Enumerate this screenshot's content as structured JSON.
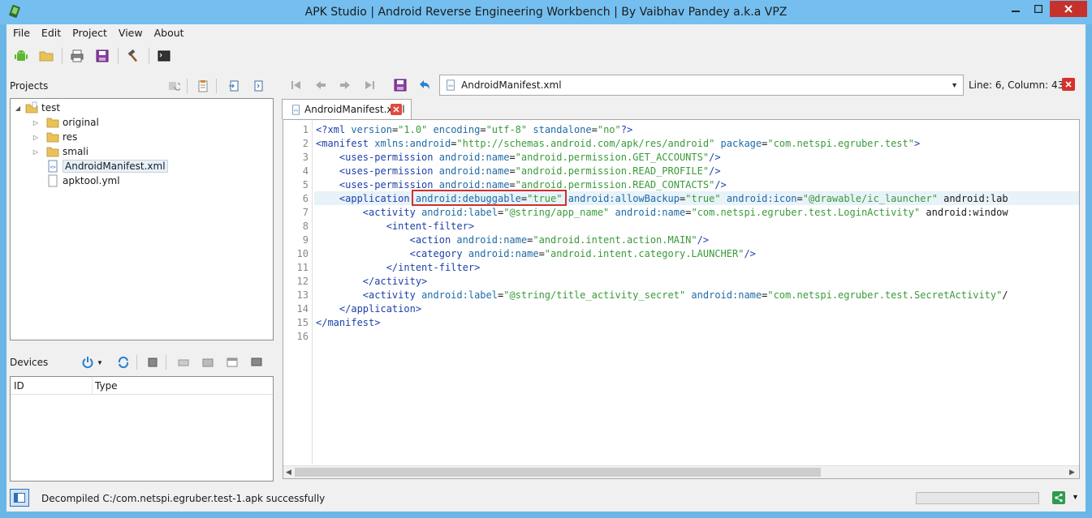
{
  "window": {
    "title": "APK Studio | Android Reverse Engineering Workbench | By Vaibhav Pandey a.k.a VPZ"
  },
  "menu": [
    "File",
    "Edit",
    "Project",
    "View",
    "About"
  ],
  "projects": {
    "title": "Projects",
    "tree": [
      {
        "label": "test",
        "level": 0,
        "expanded": true,
        "type": "project"
      },
      {
        "label": "original",
        "level": 1,
        "expanded": false,
        "type": "folder"
      },
      {
        "label": "res",
        "level": 1,
        "expanded": false,
        "type": "folder"
      },
      {
        "label": "smali",
        "level": 1,
        "expanded": false,
        "type": "folder"
      },
      {
        "label": "AndroidManifest.xml",
        "level": 1,
        "type": "xml",
        "selected": true
      },
      {
        "label": "apktool.yml",
        "level": 1,
        "type": "file"
      }
    ]
  },
  "devices": {
    "title": "Devices",
    "columns": [
      "ID",
      "Type"
    ]
  },
  "editor": {
    "open_file": "AndroidManifest.xml",
    "position": "Line: 6, Column: 43",
    "tab_label": "AndroidManifest.xml",
    "lines": [
      "<?xml version=\"1.0\" encoding=\"utf-8\" standalone=\"no\"?>",
      "<manifest xmlns:android=\"http://schemas.android.com/apk/res/android\" package=\"com.netspi.egruber.test\">",
      "    <uses-permission android:name=\"android.permission.GET_ACCOUNTS\"/>",
      "    <uses-permission android:name=\"android.permission.READ_PROFILE\"/>",
      "    <uses-permission android:name=\"android.permission.READ_CONTACTS\"/>",
      "    <application android:debuggable=\"true\" android:allowBackup=\"true\" android:icon=\"@drawable/ic_launcher\" android:lab",
      "        <activity android:label=\"@string/app_name\" android:name=\"com.netspi.egruber.test.LoginActivity\" android:window",
      "            <intent-filter>",
      "                <action android:name=\"android.intent.action.MAIN\"/>",
      "                <category android:name=\"android.intent.category.LAUNCHER\"/>",
      "            </intent-filter>",
      "        </activity>",
      "        <activity android:label=\"@string/title_activity_secret\" android:name=\"com.netspi.egruber.test.SecretActivity\"/",
      "    </application>",
      "</manifest>",
      ""
    ],
    "current_line": 6
  },
  "status": {
    "message": "Decompiled C:/com.netspi.egruber.test-1.apk successfully"
  },
  "colors": {
    "tag": "#1f3fa8",
    "attribute": "#1f6aa5",
    "string": "#3a9a3a",
    "highlight_box": "#d0302b",
    "titlebar": "#74bff0",
    "close_button": "#c7312b"
  }
}
